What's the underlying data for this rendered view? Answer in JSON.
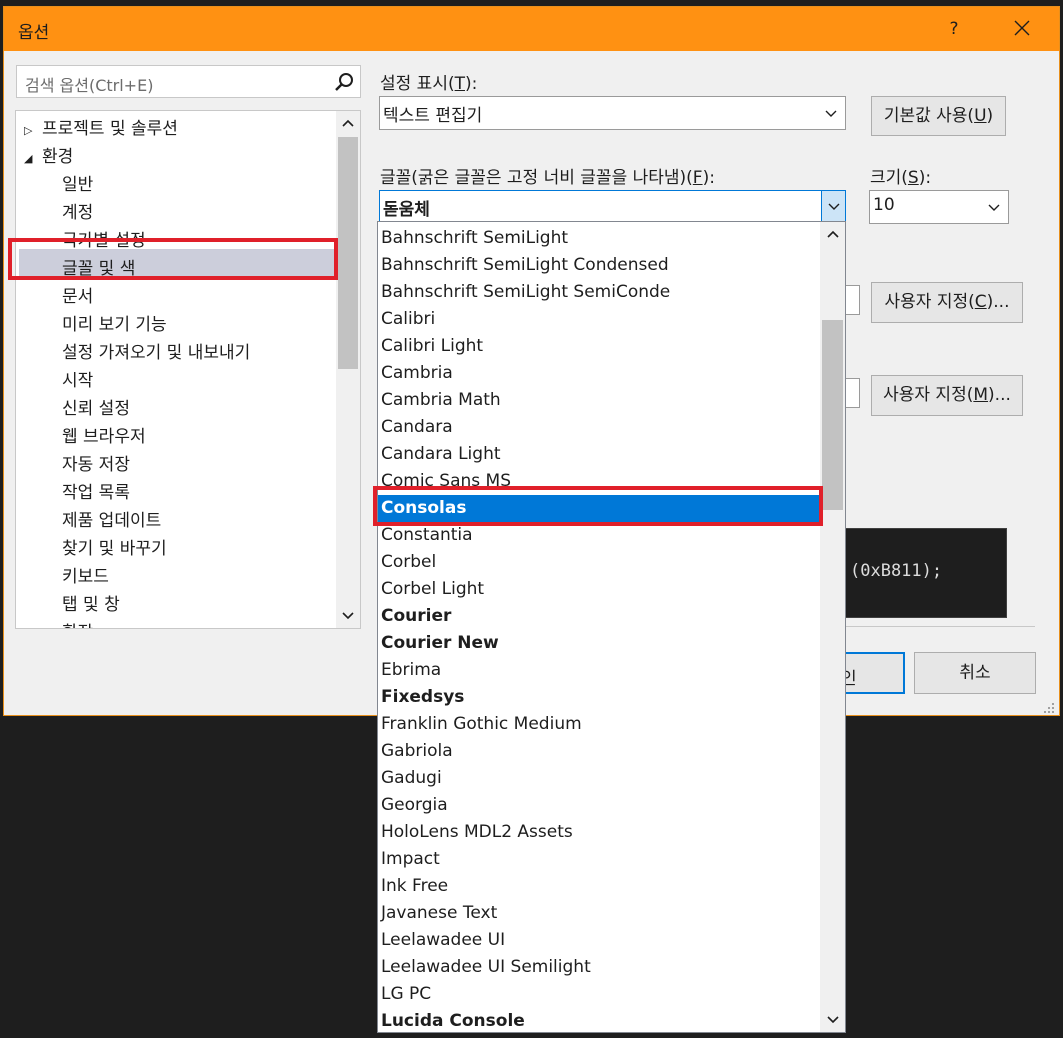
{
  "window": {
    "title": "옵션",
    "help": "?",
    "close_icon": "close-icon"
  },
  "search": {
    "placeholder": "검색 옵션(Ctrl+E)"
  },
  "tree": {
    "items": [
      {
        "label": "프로젝트 및 솔루션",
        "expander": "▷"
      },
      {
        "label": "환경",
        "expander": "◢"
      },
      {
        "label": "일반"
      },
      {
        "label": "계정"
      },
      {
        "label": "국가별 설정"
      },
      {
        "label": "글꼴 및 색"
      },
      {
        "label": "문서"
      },
      {
        "label": "미리 보기 기능"
      },
      {
        "label": "설정 가져오기 및 내보내기"
      },
      {
        "label": "시작"
      },
      {
        "label": "신뢰 설정"
      },
      {
        "label": "웹 브라우저"
      },
      {
        "label": "자동 저장"
      },
      {
        "label": "작업 목록"
      },
      {
        "label": "제품 업데이트"
      },
      {
        "label": "찾기 및 바꾸기"
      },
      {
        "label": "키보드"
      },
      {
        "label": "탭 및 창"
      },
      {
        "label": "확장"
      }
    ],
    "selected": "글꼴 및 색"
  },
  "settings": {
    "show_label": "설정 표시(",
    "show_key": "T",
    "show_suffix": "):",
    "show_value": "텍스트 편집기",
    "default_button_pre": "기본값 사용(",
    "default_button_key": "U",
    "default_button_suf": ")",
    "font_label_pre": "글꼴(굵은 글꼴은 고정 너비 글꼴을 나타냄)(",
    "font_label_key": "F",
    "font_label_suf": "):",
    "font_value": "돋움체",
    "size_label_pre": "크기(",
    "size_label_key": "S",
    "size_label_suf": "):",
    "size_value": "10",
    "custom_c_pre": "사용자 지정(",
    "custom_c_key": "C",
    "custom_c_suf": ")...",
    "custom_m_pre": "사용자 지정(",
    "custom_m_key": "M",
    "custom_m_suf": ")...",
    "preview_text": "(0xB811);",
    "ok_partial": "인",
    "cancel": "취소"
  },
  "font_list": {
    "items": [
      {
        "name": "Bahnschrift SemiLight",
        "bold": false
      },
      {
        "name": "Bahnschrift SemiLight Condensed",
        "bold": false
      },
      {
        "name": "Bahnschrift SemiLight SemiConde",
        "bold": false
      },
      {
        "name": "Calibri",
        "bold": false
      },
      {
        "name": "Calibri Light",
        "bold": false
      },
      {
        "name": "Cambria",
        "bold": false
      },
      {
        "name": "Cambria Math",
        "bold": false
      },
      {
        "name": "Candara",
        "bold": false
      },
      {
        "name": "Candara Light",
        "bold": false
      },
      {
        "name": "Comic Sans MS",
        "bold": false
      },
      {
        "name": "Consolas",
        "bold": true
      },
      {
        "name": "Constantia",
        "bold": false
      },
      {
        "name": "Corbel",
        "bold": false
      },
      {
        "name": "Corbel Light",
        "bold": false
      },
      {
        "name": "Courier",
        "bold": true
      },
      {
        "name": "Courier New",
        "bold": true
      },
      {
        "name": "Ebrima",
        "bold": false
      },
      {
        "name": "Fixedsys",
        "bold": true
      },
      {
        "name": "Franklin Gothic Medium",
        "bold": false
      },
      {
        "name": "Gabriola",
        "bold": false
      },
      {
        "name": "Gadugi",
        "bold": false
      },
      {
        "name": "Georgia",
        "bold": false
      },
      {
        "name": "HoloLens MDL2 Assets",
        "bold": false
      },
      {
        "name": "Impact",
        "bold": false
      },
      {
        "name": "Ink Free",
        "bold": false
      },
      {
        "name": "Javanese Text",
        "bold": false
      },
      {
        "name": "Leelawadee UI",
        "bold": false
      },
      {
        "name": "Leelawadee UI Semilight",
        "bold": false
      },
      {
        "name": "LG PC",
        "bold": false
      },
      {
        "name": "Lucida Console",
        "bold": true
      }
    ],
    "selected": "Consolas"
  },
  "colors": {
    "titlebar": "#ff9112",
    "highlight": "#e0202a",
    "selection": "#0078d7"
  }
}
